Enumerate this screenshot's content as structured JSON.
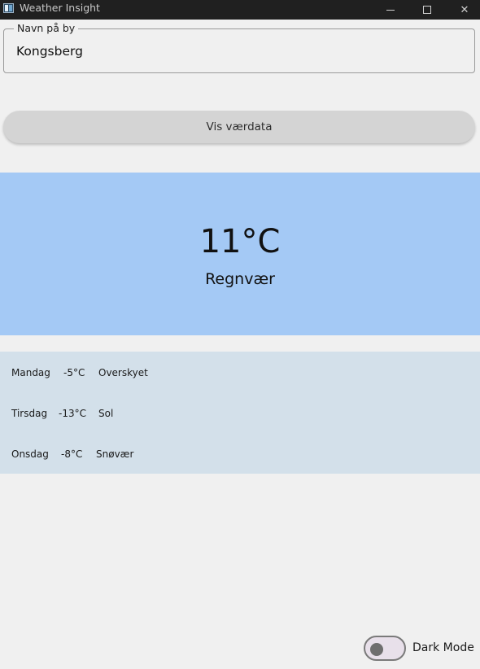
{
  "window": {
    "title": "Weather Insight",
    "controls": {
      "minimize": "minimize-icon",
      "maximize": "maximize-icon",
      "close": "close-icon"
    }
  },
  "city": {
    "label": "Navn på by",
    "value": "Kongsberg"
  },
  "button": {
    "label": "Vis værdata"
  },
  "current": {
    "temperature": "11°C",
    "condition": "Regnvær",
    "background": "#a4c9f5"
  },
  "forecast": [
    {
      "day": "Mandag",
      "temp": "-5°C",
      "condition": "Overskyet"
    },
    {
      "day": "Tirsdag",
      "temp": "-13°C",
      "condition": "Sol"
    },
    {
      "day": "Onsdag",
      "temp": "-8°C",
      "condition": "Snøvær"
    }
  ],
  "dark_mode": {
    "label": "Dark Mode",
    "enabled": false
  },
  "colors": {
    "titlebar": "#202020",
    "forecast_bg": "#d3e0ea",
    "button_bg": "#d4d4d4"
  }
}
